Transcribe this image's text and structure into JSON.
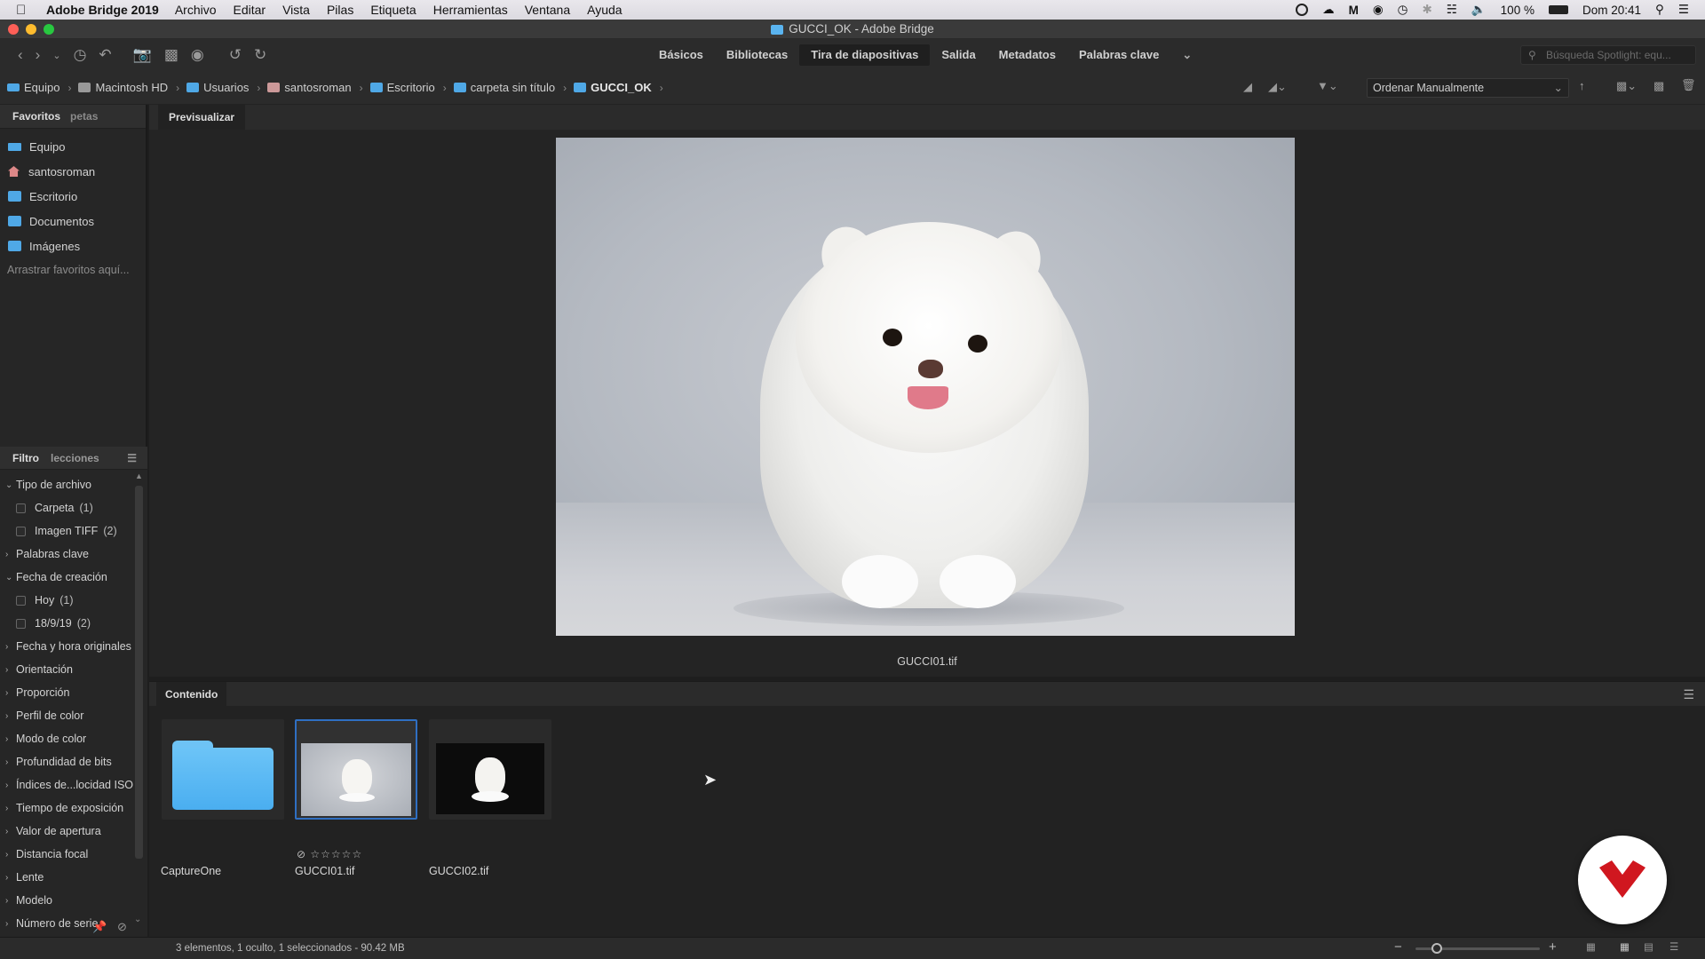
{
  "menubar": {
    "app_name": "Adobe Bridge 2019",
    "items": [
      "Archivo",
      "Editar",
      "Vista",
      "Pilas",
      "Etiqueta",
      "Herramientas",
      "Ventana",
      "Ayuda"
    ],
    "battery": "100 %",
    "clock": "Dom 20:41"
  },
  "window": {
    "title": "GUCCI_OK - Adobe Bridge"
  },
  "workspaces": [
    "Básicos",
    "Bibliotecas",
    "Tira de diapositivas",
    "Salida",
    "Metadatos",
    "Palabras clave"
  ],
  "workspaces_active": "Tira de diapositivas",
  "search": {
    "placeholder": "Búsqueda Spotlight: equ..."
  },
  "breadcrumb": [
    "Equipo",
    "Macintosh HD",
    "Usuarios",
    "santosroman",
    "Escritorio",
    "carpeta sin título",
    "GUCCI_OK"
  ],
  "sort": {
    "value": "Ordenar Manualmente"
  },
  "left_tabs": {
    "favorites": "Favoritos",
    "folders": "petas"
  },
  "favorites": [
    "Equipo",
    "santosroman",
    "Escritorio",
    "Documentos",
    "Imágenes"
  ],
  "favorites_hint": "Arrastrar favoritos aquí...",
  "filter_tabs": {
    "filter": "Filtro",
    "collections": "lecciones"
  },
  "filters": [
    {
      "label": "Tipo de archivo",
      "expanded": true,
      "options": [
        {
          "label": "Carpeta",
          "count": "(1)"
        },
        {
          "label": "Imagen TIFF",
          "count": "(2)"
        }
      ]
    },
    {
      "label": "Palabras clave",
      "expanded": false,
      "options": []
    },
    {
      "label": "Fecha de creación",
      "expanded": true,
      "options": [
        {
          "label": "Hoy",
          "count": "(1)"
        },
        {
          "label": "18/9/19",
          "count": "(2)"
        }
      ]
    },
    {
      "label": "Fecha y hora originales",
      "expanded": false,
      "options": []
    },
    {
      "label": "Orientación",
      "expanded": false,
      "options": []
    },
    {
      "label": "Proporción",
      "expanded": false,
      "options": []
    },
    {
      "label": "Perfil de color",
      "expanded": false,
      "options": []
    },
    {
      "label": "Modo de color",
      "expanded": false,
      "options": []
    },
    {
      "label": "Profundidad de bits",
      "expanded": false,
      "options": []
    },
    {
      "label": "Índices de...locidad ISO",
      "expanded": false,
      "options": []
    },
    {
      "label": "Tiempo de exposición",
      "expanded": false,
      "options": []
    },
    {
      "label": "Valor de apertura",
      "expanded": false,
      "options": []
    },
    {
      "label": "Distancia focal",
      "expanded": false,
      "options": []
    },
    {
      "label": "Lente",
      "expanded": false,
      "options": []
    },
    {
      "label": "Modelo",
      "expanded": false,
      "options": []
    },
    {
      "label": "Número de serie",
      "expanded": false,
      "options": []
    }
  ],
  "preview": {
    "tab": "Previsualizar",
    "caption": "GUCCI01.tif"
  },
  "content": {
    "tab": "Contenido",
    "items": [
      {
        "name": "CaptureOne",
        "kind": "folder",
        "selected": false
      },
      {
        "name": "GUCCI01.tif",
        "kind": "image-light",
        "selected": true
      },
      {
        "name": "GUCCI02.tif",
        "kind": "image-dark",
        "selected": false
      }
    ],
    "rating": "☆☆☆☆☆"
  },
  "status": {
    "text": "3 elementos, 1 oculto, 1 seleccionados - 90.42 MB"
  },
  "colors": {
    "accent": "#2f6fc2",
    "folder": "#5ab4f0",
    "badge": "#d0171f"
  }
}
